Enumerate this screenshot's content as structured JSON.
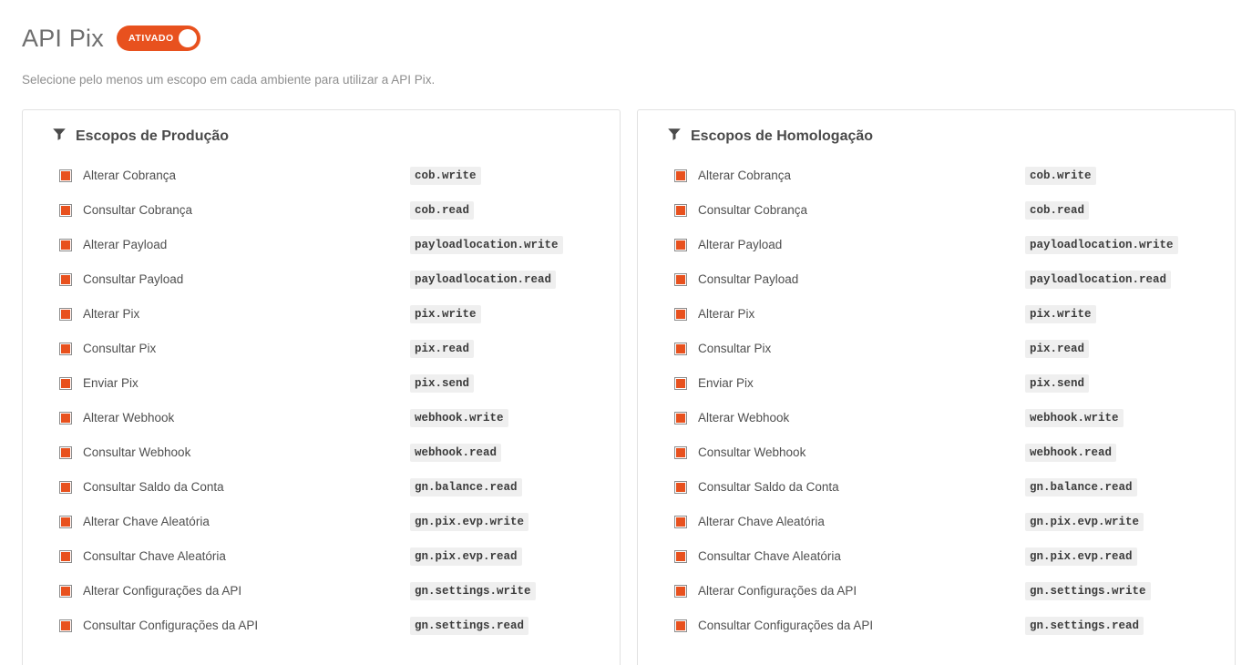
{
  "header": {
    "title": "API Pix",
    "toggle": {
      "label": "ATIVADO",
      "state": "on",
      "color": "#e8511e"
    }
  },
  "subtitle": "Selecione pelo menos um escopo em cada ambiente para utilizar a API Pix.",
  "cards": [
    {
      "icon": "funnel-icon",
      "title": "Escopos de Produção",
      "scopes": [
        {
          "label": "Alterar Cobrança",
          "code": "cob.write",
          "checked": true
        },
        {
          "label": "Consultar Cobrança",
          "code": "cob.read",
          "checked": true
        },
        {
          "label": "Alterar Payload",
          "code": "payloadlocation.write",
          "checked": true
        },
        {
          "label": "Consultar Payload",
          "code": "payloadlocation.read",
          "checked": true
        },
        {
          "label": "Alterar Pix",
          "code": "pix.write",
          "checked": true
        },
        {
          "label": "Consultar Pix",
          "code": "pix.read",
          "checked": true
        },
        {
          "label": "Enviar Pix",
          "code": "pix.send",
          "checked": true
        },
        {
          "label": "Alterar Webhook",
          "code": "webhook.write",
          "checked": true
        },
        {
          "label": "Consultar Webhook",
          "code": "webhook.read",
          "checked": true
        },
        {
          "label": "Consultar Saldo da Conta",
          "code": "gn.balance.read",
          "checked": true
        },
        {
          "label": "Alterar Chave Aleatória",
          "code": "gn.pix.evp.write",
          "checked": true
        },
        {
          "label": "Consultar Chave Aleatória",
          "code": "gn.pix.evp.read",
          "checked": true
        },
        {
          "label": "Alterar Configurações da API",
          "code": "gn.settings.write",
          "checked": true
        },
        {
          "label": "Consultar Configurações da API",
          "code": "gn.settings.read",
          "checked": true
        }
      ]
    },
    {
      "icon": "funnel-icon",
      "title": "Escopos de Homologação",
      "scopes": [
        {
          "label": "Alterar Cobrança",
          "code": "cob.write",
          "checked": true
        },
        {
          "label": "Consultar Cobrança",
          "code": "cob.read",
          "checked": true
        },
        {
          "label": "Alterar Payload",
          "code": "payloadlocation.write",
          "checked": true
        },
        {
          "label": "Consultar Payload",
          "code": "payloadlocation.read",
          "checked": true
        },
        {
          "label": "Alterar Pix",
          "code": "pix.write",
          "checked": true
        },
        {
          "label": "Consultar Pix",
          "code": "pix.read",
          "checked": true
        },
        {
          "label": "Enviar Pix",
          "code": "pix.send",
          "checked": true
        },
        {
          "label": "Alterar Webhook",
          "code": "webhook.write",
          "checked": true
        },
        {
          "label": "Consultar Webhook",
          "code": "webhook.read",
          "checked": true
        },
        {
          "label": "Consultar Saldo da Conta",
          "code": "gn.balance.read",
          "checked": true
        },
        {
          "label": "Alterar Chave Aleatória",
          "code": "gn.pix.evp.write",
          "checked": true
        },
        {
          "label": "Consultar Chave Aleatória",
          "code": "gn.pix.evp.read",
          "checked": true
        },
        {
          "label": "Alterar Configurações da API",
          "code": "gn.settings.write",
          "checked": true
        },
        {
          "label": "Consultar Configurações da API",
          "code": "gn.settings.read",
          "checked": true
        }
      ]
    }
  ]
}
